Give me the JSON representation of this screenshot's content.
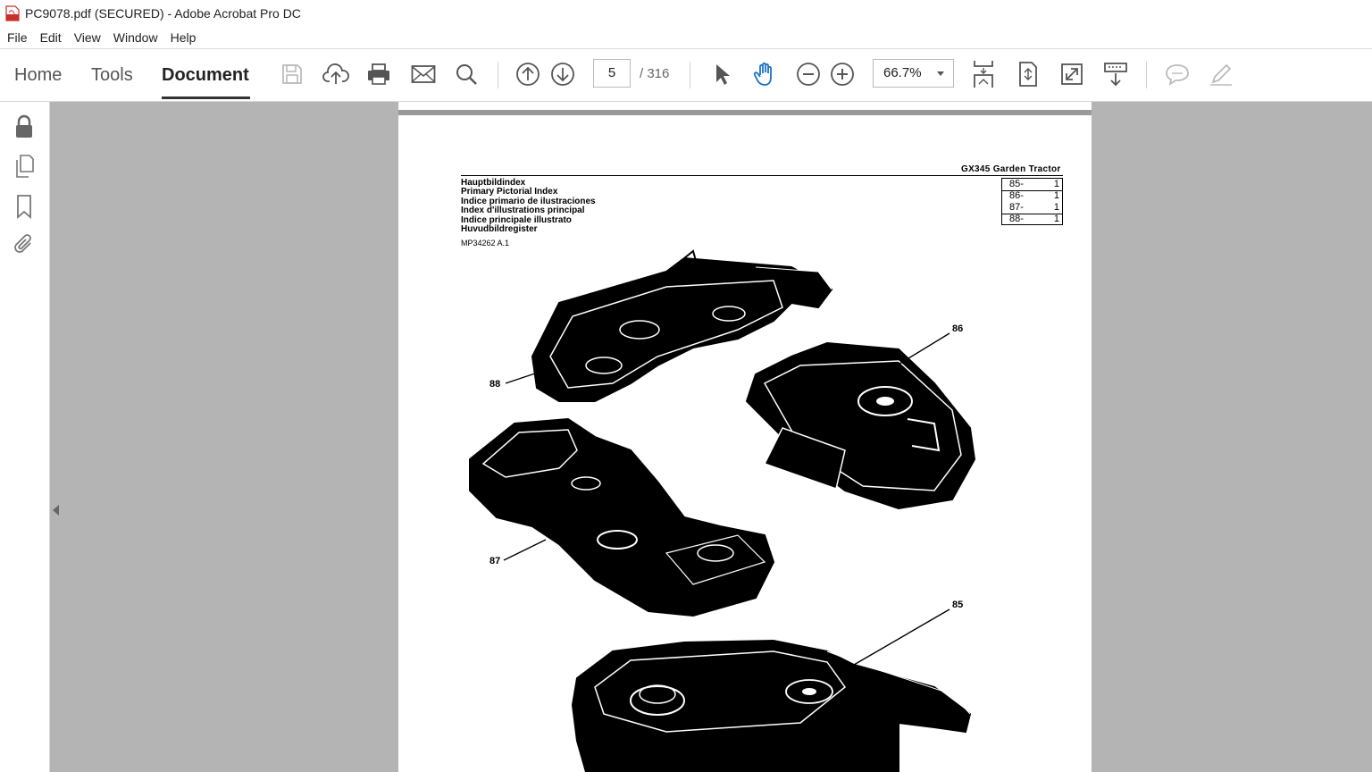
{
  "window": {
    "title": "PC9078.pdf (SECURED) - Adobe Acrobat Pro DC"
  },
  "menu": {
    "items": [
      "File",
      "Edit",
      "View",
      "Window",
      "Help"
    ]
  },
  "toolbar": {
    "tabs": [
      "Home",
      "Tools",
      "Document"
    ],
    "active_tab": "Document",
    "page_current": "5",
    "page_total": "/ 316",
    "zoom": "66.7%"
  },
  "document": {
    "heading": "GX345  Garden  Tractor",
    "index_titles": [
      "Hauptbildindex",
      "Primary Pictorial Index",
      "Indice primario de ilustraciones",
      "Index d'illustrations principal",
      "Indice principale illustrato",
      "Huvudbildregister"
    ],
    "figure_code": "MP34262 A.1",
    "references": [
      {
        "code": "85-",
        "qty": "1"
      },
      {
        "code": "86-",
        "qty": "1"
      },
      {
        "code": "87-",
        "qty": "1"
      },
      {
        "code": "88-",
        "qty": "1"
      }
    ],
    "callouts": [
      "86",
      "88",
      "87",
      "85"
    ]
  },
  "colors": {
    "doc_background": "#b4b4b4",
    "accent_blue": "#1a73c8",
    "icon_gray": "#555555"
  }
}
